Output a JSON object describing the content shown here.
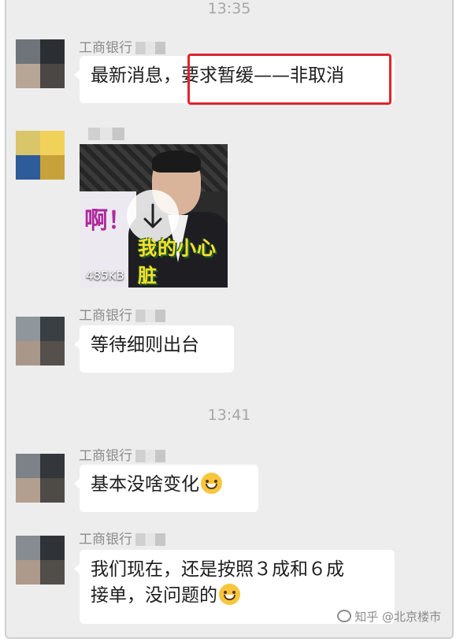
{
  "chat": {
    "timestamps": [
      "13:35",
      "13:41"
    ],
    "messages": [
      {
        "sender": "工商银行",
        "text": "最新消息，要求暂缓——非取消",
        "highlighted_text": "要求暂缓——非取消"
      },
      {
        "sender": "",
        "sticker": {
          "size_label": "485KB",
          "caption": "我的小心脏",
          "banner_text": "啊！",
          "action_icon": "download-arrow-icon"
        }
      },
      {
        "sender": "工商银行",
        "text": "等待细则出台"
      },
      {
        "sender": "工商银行",
        "text": "基本没啥变化",
        "emoji": "grinning-face"
      },
      {
        "sender": "工商银行",
        "text_line1": "我们现在，还是按照３成和６成",
        "text_line2": "接单，没问题的",
        "emoji": "grinning-face"
      }
    ]
  },
  "watermark": {
    "text": "知乎 @北京楼市"
  },
  "colors": {
    "background": "#ededed",
    "bubble": "#ffffff",
    "highlight_border": "#e0242b",
    "timestamp": "#a7a7a7"
  }
}
